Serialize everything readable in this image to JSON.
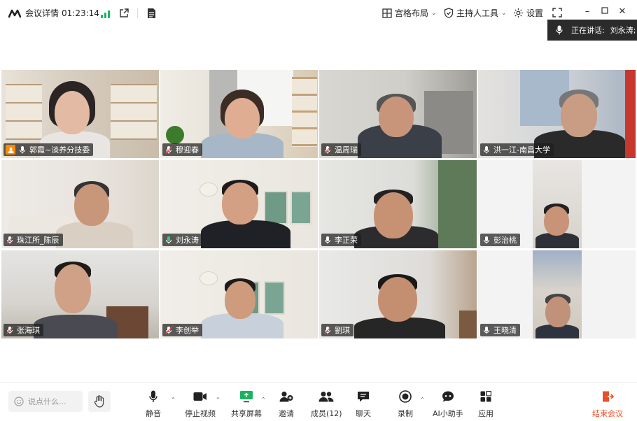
{
  "app": {
    "title": "会议详情",
    "timer": "01:23:14"
  },
  "top_controls": {
    "layout_label": "宫格布局",
    "host_tools_label": "主持人工具",
    "settings_label": "设置"
  },
  "speaking": {
    "label": "正在讲话:",
    "name": "刘永涛;"
  },
  "participants": [
    {
      "name": "郭霞~淡养分技委",
      "host": true,
      "active": false
    },
    {
      "name": "穆迎春",
      "host": false,
      "active": false
    },
    {
      "name": "温周瑞",
      "host": false,
      "active": false
    },
    {
      "name": "洪一江-南昌大学",
      "host": false,
      "active": false
    },
    {
      "name": "珠江所_陈辰",
      "host": false,
      "active": false
    },
    {
      "name": "刘永涛",
      "host": false,
      "active": true
    },
    {
      "name": "李正荣",
      "host": false,
      "active": false
    },
    {
      "name": "彭治桃",
      "host": false,
      "active": false
    },
    {
      "name": "张海琪",
      "host": false,
      "active": false
    },
    {
      "name": "李创举",
      "host": false,
      "active": false
    },
    {
      "name": "劉琪",
      "host": false,
      "active": false
    },
    {
      "name": "王晓清",
      "host": false,
      "active": false
    }
  ],
  "toolbar": {
    "chat_placeholder": "说点什么...",
    "mute_label": "静音",
    "video_label": "停止视频",
    "share_label": "共享屏幕",
    "invite_label": "邀请",
    "members_label": "成员(12)",
    "chat_label": "聊天",
    "record_label": "录制",
    "ai_label": "AI小助手",
    "apps_label": "应用",
    "end_label": "结束会议"
  },
  "colors": {
    "accent_green": "#3cc67a",
    "signal_green": "#19b35f",
    "end_red": "#e5512b",
    "host_orange": "#ff8a00"
  }
}
